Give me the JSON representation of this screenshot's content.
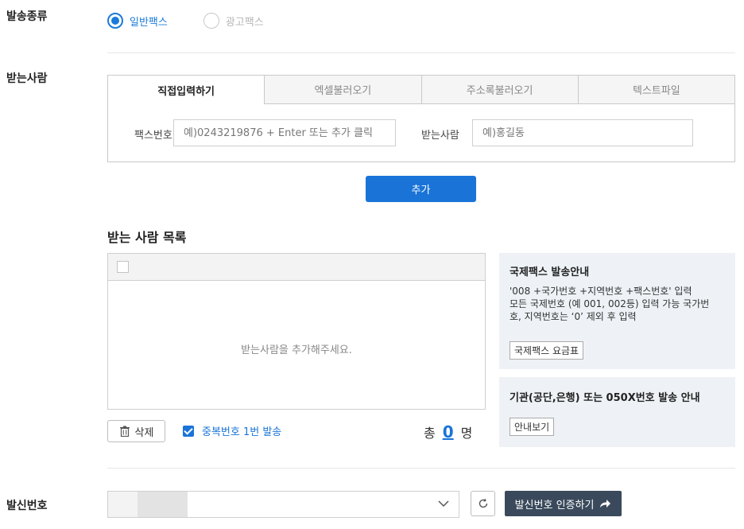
{
  "send_type": {
    "label": "발송종류",
    "options": [
      {
        "label": "일반팩스",
        "selected": true
      },
      {
        "label": "광고팩스",
        "selected": false
      }
    ]
  },
  "recipient": {
    "label": "받는사람",
    "tabs": [
      "직접입력하기",
      "엑셀불러오기",
      "주소록불러오기",
      "텍스트파일"
    ],
    "fax_label": "팩스번호",
    "fax_placeholder": "예)0243219876 + Enter 또는 추가 클릭",
    "name_label": "받는사람",
    "name_placeholder": "예)홍길동",
    "add_button": "추가"
  },
  "recipient_list": {
    "title": "받는 사람 목록",
    "empty_message": "받는사람을 추가해주세요.",
    "delete_button": "삭제",
    "dedupe_label": "중복번호 1번 발송",
    "total_prefix": "총",
    "total_count": "0",
    "total_suffix": "명"
  },
  "intl_info": {
    "title": "국제팩스 발송안내",
    "line1": "'008 +국가번호 +지역번호 +팩스번호' 입력",
    "line2": "모든 국제번호 (예 001, 002등) 입력 가능 국가번",
    "line3": "호, 지역번호는 ‘0’ 제외 후 입력",
    "rate_button": "국제팩스 요금표"
  },
  "inst_info": {
    "title": "기관(공단,은행) 또는 050X번호 발송 안내",
    "guide_button": "안내보기"
  },
  "sender": {
    "label": "발신번호",
    "verify_button": "발신번호 인증하기"
  },
  "colors": {
    "accent": "#1a74d8",
    "dark_button": "#3a4a5c",
    "info_bg": "#eef2f6"
  }
}
